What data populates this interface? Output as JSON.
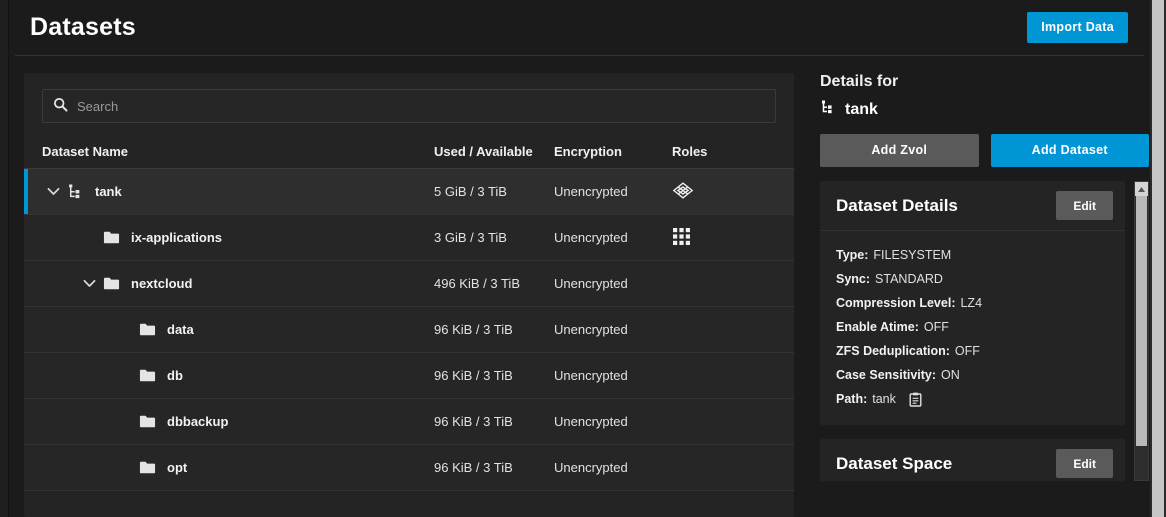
{
  "theme": {
    "accent": "#0095d5",
    "grey_button": "#5a5a5a",
    "page_bg": "#1b1b1b",
    "card_bg": "#242424",
    "row_bg": "#262626",
    "row_selected_bg": "#2e2e2e"
  },
  "header": {
    "title": "Datasets",
    "import_button": "Import Data"
  },
  "search": {
    "placeholder": "Search",
    "value": ""
  },
  "table": {
    "columns": {
      "name": "Dataset Name",
      "used": "Used / Available",
      "encryption": "Encryption",
      "roles": "Roles"
    },
    "rows": [
      {
        "name": "tank",
        "used": "5 GiB / 3 TiB",
        "encryption": "Unencrypted",
        "roles_icon": "pool-diamond-icon",
        "icon": "dataset-tree-icon",
        "indent": 0,
        "expanded": true,
        "selected": true
      },
      {
        "name": "ix-applications",
        "used": "3 GiB / 3 TiB",
        "encryption": "Unencrypted",
        "roles_icon": "apps-grid-icon",
        "icon": "folder-icon",
        "indent": 1,
        "expanded": null,
        "selected": false
      },
      {
        "name": "nextcloud",
        "used": "496 KiB / 3 TiB",
        "encryption": "Unencrypted",
        "roles_icon": "",
        "icon": "folder-icon",
        "indent": 1,
        "expanded": true,
        "selected": false
      },
      {
        "name": "data",
        "used": "96 KiB / 3 TiB",
        "encryption": "Unencrypted",
        "roles_icon": "",
        "icon": "folder-icon",
        "indent": 2,
        "expanded": null,
        "selected": false
      },
      {
        "name": "db",
        "used": "96 KiB / 3 TiB",
        "encryption": "Unencrypted",
        "roles_icon": "",
        "icon": "folder-icon",
        "indent": 2,
        "expanded": null,
        "selected": false
      },
      {
        "name": "dbbackup",
        "used": "96 KiB / 3 TiB",
        "encryption": "Unencrypted",
        "roles_icon": "",
        "icon": "folder-icon",
        "indent": 2,
        "expanded": null,
        "selected": false
      },
      {
        "name": "opt",
        "used": "96 KiB / 3 TiB",
        "encryption": "Unencrypted",
        "roles_icon": "",
        "icon": "folder-icon",
        "indent": 2,
        "expanded": null,
        "selected": false
      }
    ]
  },
  "details": {
    "heading": "Details for",
    "subject": "tank",
    "subject_icon": "dataset-tree-icon",
    "add_zvol_button": "Add Zvol",
    "add_dataset_button": "Add Dataset",
    "cards": [
      {
        "title": "Dataset Details",
        "edit_label": "Edit",
        "fields": [
          {
            "key": "Type:",
            "value": "FILESYSTEM"
          },
          {
            "key": "Sync:",
            "value": "STANDARD"
          },
          {
            "key": "Compression Level:",
            "value": "LZ4"
          },
          {
            "key": "Enable Atime:",
            "value": "OFF"
          },
          {
            "key": "ZFS Deduplication:",
            "value": "OFF"
          },
          {
            "key": "Case Sensitivity:",
            "value": "ON"
          },
          {
            "key": "Path:",
            "value": "tank",
            "copy_icon": "clipboard-copy-icon"
          }
        ]
      },
      {
        "title": "Dataset Space",
        "edit_label": "Edit",
        "fields": []
      }
    ]
  }
}
